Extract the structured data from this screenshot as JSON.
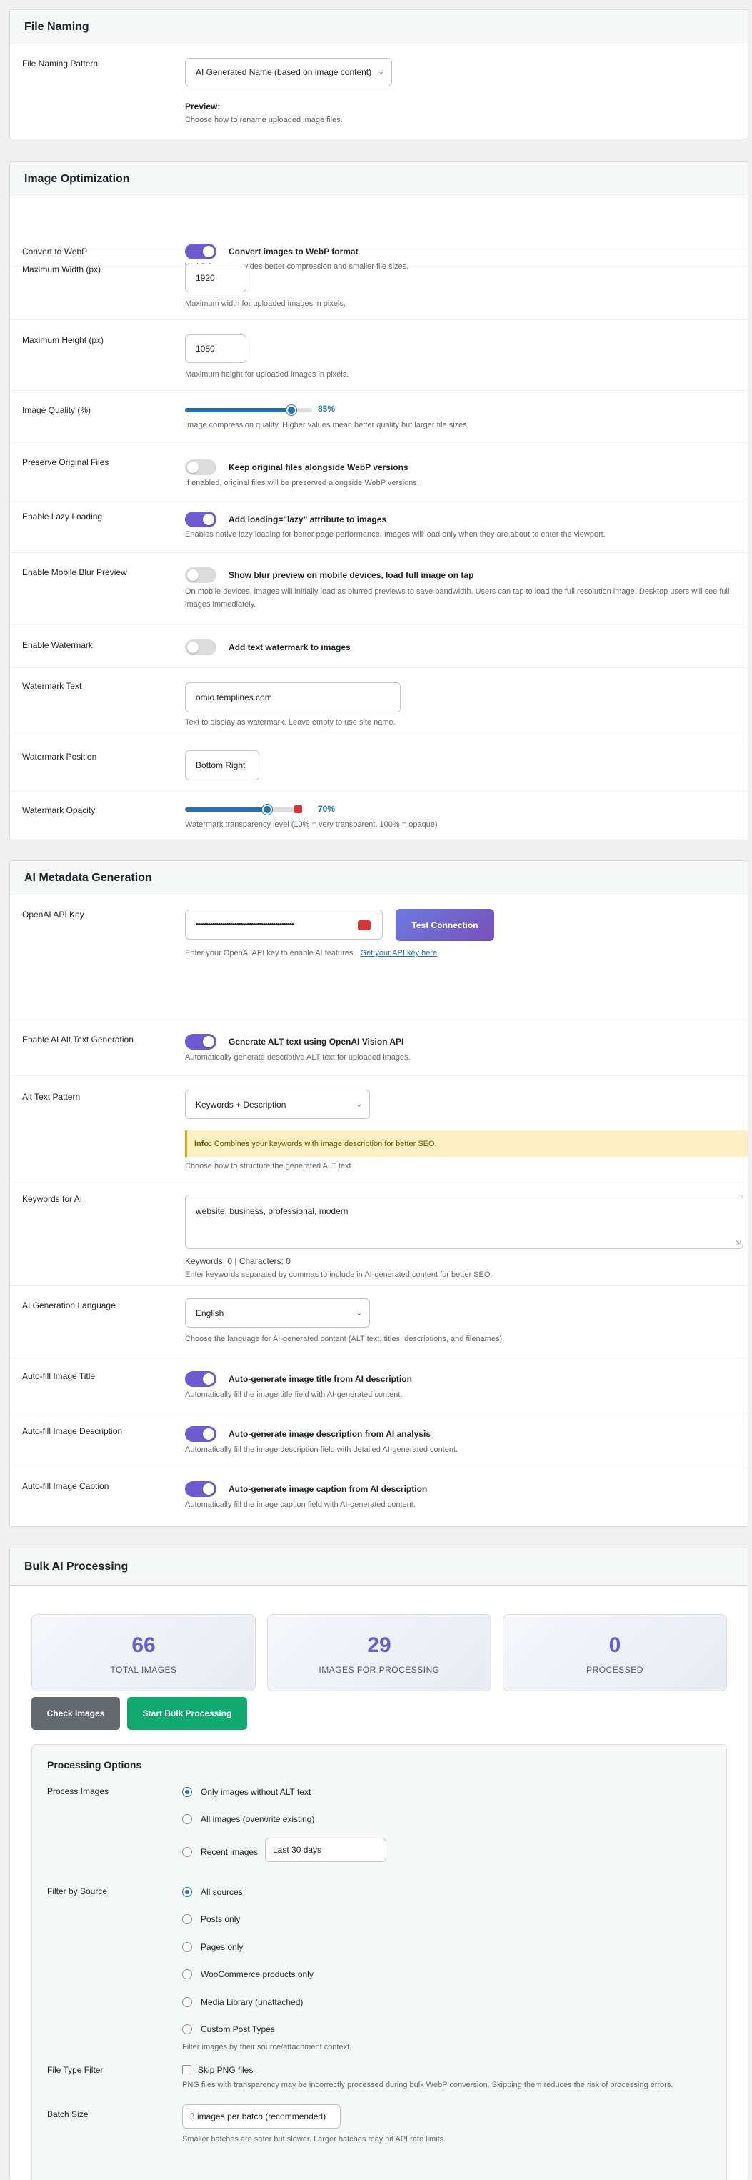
{
  "file_naming": {
    "title": "File Naming",
    "pattern_label": "File Naming Pattern",
    "pattern_value": "AI Generated Name (based on image content)",
    "preview_label": "Preview:",
    "preview_desc": "Choose how to rename uploaded image files."
  },
  "image_optimization": {
    "title": "Image Optimization",
    "webp": {
      "label": "Convert to WebP",
      "text": "Convert images to WebP format",
      "desc": "WebP format provides better compression and smaller file sizes.",
      "on": true
    },
    "max_width": {
      "label": "Maximum Width (px)",
      "value": "1920",
      "desc": "Maximum width for uploaded images in pixels."
    },
    "max_height": {
      "label": "Maximum Height (px)",
      "value": "1080",
      "desc": "Maximum height for uploaded images in pixels."
    },
    "quality": {
      "label": "Image Quality (%)",
      "value": "85%",
      "level": 85,
      "desc": "Image compression quality. Higher values mean better quality but larger file sizes."
    },
    "preserve": {
      "label": "Preserve Original Files",
      "text": "Keep original files alongside WebP versions",
      "desc": "If enabled, original files will be preserved alongside WebP versions.",
      "on": false
    },
    "lazy": {
      "label": "Enable Lazy Loading",
      "text": "Add loading=\"lazy\" attribute to images",
      "desc": "Enables native lazy loading for better page performance. Images will load only when they are about to enter the viewport.",
      "on": true
    },
    "blur": {
      "label": "Enable Mobile Blur Preview",
      "text": "Show blur preview on mobile devices, load full image on tap",
      "desc": "On mobile devices, images will initially load as blurred previews to save bandwidth. Users can tap to load the full resolution image. Desktop users will see full images immediately.",
      "on": false
    },
    "watermark": {
      "label": "Enable Watermark",
      "text": "Add text watermark to images",
      "on": false
    },
    "watermark_text": {
      "label": "Watermark Text",
      "value": "omio.templines.com",
      "desc": "Text to display as watermark. Leave empty to use site name."
    },
    "watermark_position": {
      "label": "Watermark Position",
      "value": "Bottom Right"
    },
    "watermark_opacity": {
      "label": "Watermark Opacity",
      "value": "70%",
      "level": 70,
      "desc": "Watermark transparency level (10% = very transparent, 100% = opaque)"
    }
  },
  "ai_metadata": {
    "title": "AI Metadata Generation",
    "api_key": {
      "label": "OpenAI API Key",
      "value": "••••••••••••••••••••••••••••••••••••••••••••••••",
      "button": "Test Connection",
      "desc": "Enter your OpenAI API key to enable AI features.",
      "link": "Get your API key here"
    },
    "alt_text": {
      "label": "Enable AI Alt Text Generation",
      "text": "Generate ALT text using OpenAI Vision API",
      "desc": "Automatically generate descriptive ALT text for uploaded images.",
      "on": true
    },
    "alt_pattern": {
      "label": "Alt Text Pattern",
      "value": "Keywords + Description",
      "info_bold": "Info:",
      "info_text": "Combines your keywords with image description for better SEO.",
      "desc": "Choose how to structure the generated ALT text."
    },
    "keywords": {
      "label": "Keywords for AI",
      "value": "website, business, professional, modern",
      "counter": "Keywords: 0 | Characters: 0",
      "desc": "Enter keywords separated by commas to include in AI-generated content for better SEO."
    },
    "language": {
      "label": "AI Generation Language",
      "value": "English",
      "desc": "Choose the language for AI-generated content (ALT text, titles, descriptions, and filenames)."
    },
    "fill_title": {
      "label": "Auto-fill Image Title",
      "text": "Auto-generate image title from AI description",
      "desc": "Automatically fill the image title field with AI-generated content.",
      "on": true
    },
    "fill_desc": {
      "label": "Auto-fill Image Description",
      "text": "Auto-generate image description from AI analysis",
      "desc": "Automatically fill the image description field with detailed AI-generated content.",
      "on": true
    },
    "fill_caption": {
      "label": "Auto-fill Image Caption",
      "text": "Auto-generate image caption from AI description",
      "desc": "Automatically fill the image caption field with AI-generated content.",
      "on": true
    }
  },
  "bulk": {
    "title": "Bulk AI Processing",
    "stats": [
      {
        "value": "66",
        "label": "TOTAL IMAGES"
      },
      {
        "value": "29",
        "label": "IMAGES FOR PROCESSING"
      },
      {
        "value": "0",
        "label": "PROCESSED"
      }
    ],
    "check_button": "Check Images",
    "start_button": "Start Bulk Processing",
    "options_title": "Processing Options",
    "process_label": "Process Images",
    "process_options": [
      "Only images without ALT text",
      "All images (overwrite existing)",
      "Recent images"
    ],
    "recent_value": "Last 30 days",
    "filter_label": "Filter by Source",
    "filter_options": [
      "All sources",
      "Posts only",
      "Pages only",
      "WooCommerce products only",
      "Media Library (unattached)",
      "Custom Post Types"
    ],
    "filter_desc": "Filter images by their source/attachment context.",
    "filetype_label": "File Type Filter",
    "skip_png": "Skip PNG files",
    "filetype_desc": "PNG files with transparency may be incorrectly processed during bulk WebP conversion. Skipping them reduces the risk of processing errors.",
    "batch_label": "Batch Size",
    "batch_value": "3 images per batch (recommended)",
    "batch_desc": "Smaller batches are safer but slower. Larger batches may hit API rate limits."
  },
  "colors": {
    "accent": "#6c5ccf",
    "blue": "#2271b1",
    "green": "#12a970",
    "gray_button": "#646970",
    "info_bg": "#fcf0c3"
  }
}
